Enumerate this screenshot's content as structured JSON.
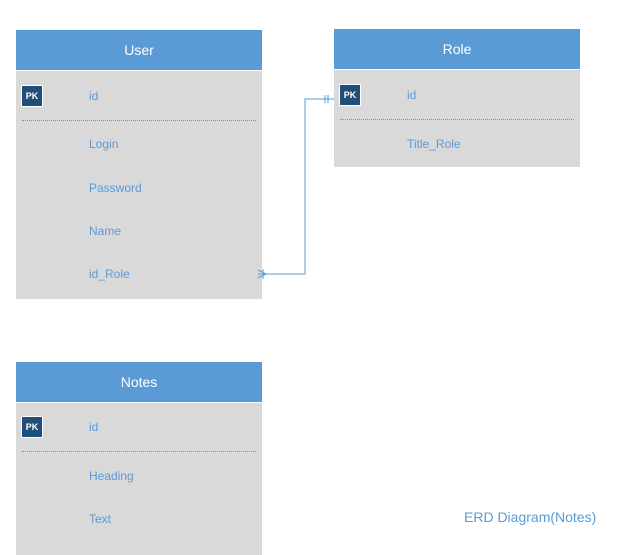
{
  "entities": {
    "user": {
      "title": "User",
      "pk_label": "PK",
      "pk_field": "id",
      "fields": [
        "Login",
        "Password",
        "Name",
        "id_Role"
      ]
    },
    "role": {
      "title": "Role",
      "pk_label": "PK",
      "pk_field": "id",
      "fields": [
        "Title_Role"
      ]
    },
    "notes": {
      "title": "Notes",
      "pk_label": "PK",
      "pk_field": "id",
      "fields": [
        "Heading",
        "Text"
      ]
    }
  },
  "relationship": {
    "from": "user.id_Role",
    "to": "role.id",
    "from_end": "many",
    "to_end": "one-and-only-one"
  },
  "caption": "ERD Diagram(Notes)",
  "colors": {
    "header": "#5b9bd5",
    "body": "#d9d9d9",
    "pk_badge": "#1f4e79",
    "field_text": "#5b9bd5",
    "connector": "#5b9bd5"
  }
}
